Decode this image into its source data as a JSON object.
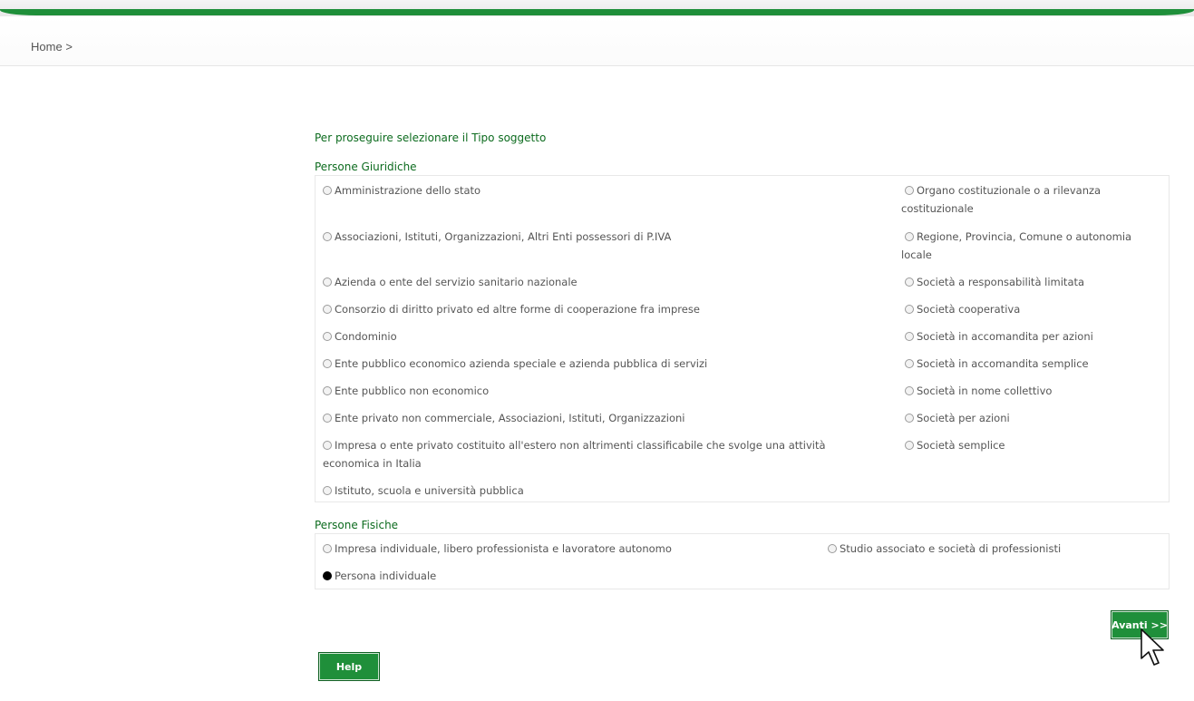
{
  "breadcrumb": {
    "home": "Home",
    "separator": ">"
  },
  "prompt": "Per proseguire selezionare il Tipo soggetto",
  "giuridiche": {
    "title": "Persone Giuridiche",
    "left": [
      "Amministrazione dello stato",
      "Associazioni, Istituti, Organizzazioni, Altri Enti possessori di P.IVA",
      "Azienda o ente del servizio sanitario nazionale",
      "Consorzio di diritto privato ed altre forme di cooperazione fra imprese",
      "Condominio",
      "Ente pubblico economico azienda speciale e azienda pubblica di servizi",
      "Ente pubblico non economico",
      "Ente privato non commerciale, Associazioni, Istituti, Organizzazioni",
      "Impresa o ente privato costituito all'estero non altrimenti classificabile che svolge una attività",
      "economica in Italia",
      "Istituto, scuola e università pubblica"
    ],
    "right": [
      "Organo costituzionale o a rilevanza",
      "costituzionale",
      "Regione, Provincia, Comune o autonomia",
      "locale",
      "Società a responsabilità limitata",
      "Società cooperativa",
      "Società in accomandita per azioni",
      "Società in accomandita semplice",
      "Società in nome collettivo",
      "Società per azioni",
      "Società semplice"
    ]
  },
  "fisiche": {
    "title": "Persone Fisiche",
    "options": [
      "Impresa individuale, libero professionista e lavoratore autonomo",
      "Studio associato e società di professionisti",
      "Persona individuale"
    ],
    "selected": "Persona individuale"
  },
  "buttons": {
    "next": "Avanti >>",
    "help": "Help"
  },
  "colors": {
    "accent": "#1f8f3a",
    "heading": "#0c6b1e"
  }
}
